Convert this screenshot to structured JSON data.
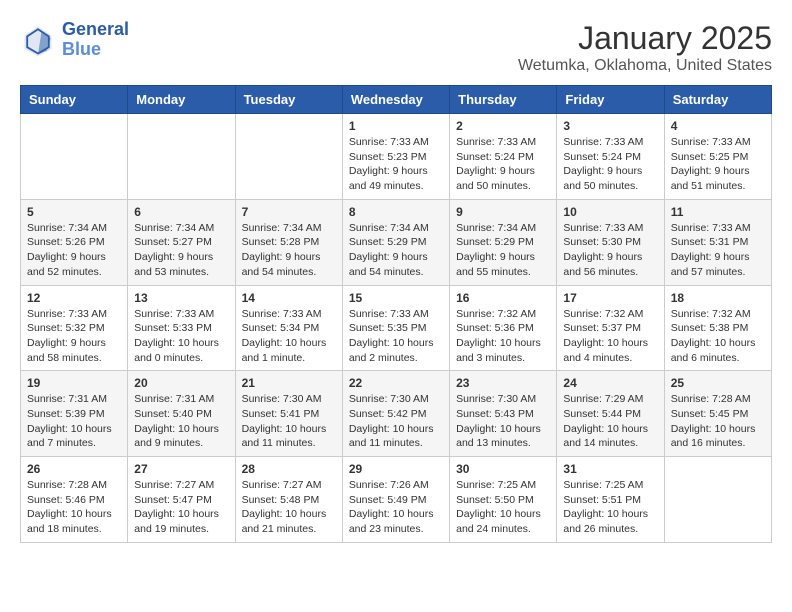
{
  "logo": {
    "line1": "General",
    "line2": "Blue"
  },
  "title": "January 2025",
  "subtitle": "Wetumka, Oklahoma, United States",
  "weekdays": [
    "Sunday",
    "Monday",
    "Tuesday",
    "Wednesday",
    "Thursday",
    "Friday",
    "Saturday"
  ],
  "weeks": [
    [
      {
        "day": "",
        "info": ""
      },
      {
        "day": "",
        "info": ""
      },
      {
        "day": "",
        "info": ""
      },
      {
        "day": "1",
        "info": "Sunrise: 7:33 AM\nSunset: 5:23 PM\nDaylight: 9 hours\nand 49 minutes."
      },
      {
        "day": "2",
        "info": "Sunrise: 7:33 AM\nSunset: 5:24 PM\nDaylight: 9 hours\nand 50 minutes."
      },
      {
        "day": "3",
        "info": "Sunrise: 7:33 AM\nSunset: 5:24 PM\nDaylight: 9 hours\nand 50 minutes."
      },
      {
        "day": "4",
        "info": "Sunrise: 7:33 AM\nSunset: 5:25 PM\nDaylight: 9 hours\nand 51 minutes."
      }
    ],
    [
      {
        "day": "5",
        "info": "Sunrise: 7:34 AM\nSunset: 5:26 PM\nDaylight: 9 hours\nand 52 minutes."
      },
      {
        "day": "6",
        "info": "Sunrise: 7:34 AM\nSunset: 5:27 PM\nDaylight: 9 hours\nand 53 minutes."
      },
      {
        "day": "7",
        "info": "Sunrise: 7:34 AM\nSunset: 5:28 PM\nDaylight: 9 hours\nand 54 minutes."
      },
      {
        "day": "8",
        "info": "Sunrise: 7:34 AM\nSunset: 5:29 PM\nDaylight: 9 hours\nand 54 minutes."
      },
      {
        "day": "9",
        "info": "Sunrise: 7:34 AM\nSunset: 5:29 PM\nDaylight: 9 hours\nand 55 minutes."
      },
      {
        "day": "10",
        "info": "Sunrise: 7:33 AM\nSunset: 5:30 PM\nDaylight: 9 hours\nand 56 minutes."
      },
      {
        "day": "11",
        "info": "Sunrise: 7:33 AM\nSunset: 5:31 PM\nDaylight: 9 hours\nand 57 minutes."
      }
    ],
    [
      {
        "day": "12",
        "info": "Sunrise: 7:33 AM\nSunset: 5:32 PM\nDaylight: 9 hours\nand 58 minutes."
      },
      {
        "day": "13",
        "info": "Sunrise: 7:33 AM\nSunset: 5:33 PM\nDaylight: 10 hours\nand 0 minutes."
      },
      {
        "day": "14",
        "info": "Sunrise: 7:33 AM\nSunset: 5:34 PM\nDaylight: 10 hours\nand 1 minute."
      },
      {
        "day": "15",
        "info": "Sunrise: 7:33 AM\nSunset: 5:35 PM\nDaylight: 10 hours\nand 2 minutes."
      },
      {
        "day": "16",
        "info": "Sunrise: 7:32 AM\nSunset: 5:36 PM\nDaylight: 10 hours\nand 3 minutes."
      },
      {
        "day": "17",
        "info": "Sunrise: 7:32 AM\nSunset: 5:37 PM\nDaylight: 10 hours\nand 4 minutes."
      },
      {
        "day": "18",
        "info": "Sunrise: 7:32 AM\nSunset: 5:38 PM\nDaylight: 10 hours\nand 6 minutes."
      }
    ],
    [
      {
        "day": "19",
        "info": "Sunrise: 7:31 AM\nSunset: 5:39 PM\nDaylight: 10 hours\nand 7 minutes."
      },
      {
        "day": "20",
        "info": "Sunrise: 7:31 AM\nSunset: 5:40 PM\nDaylight: 10 hours\nand 9 minutes."
      },
      {
        "day": "21",
        "info": "Sunrise: 7:30 AM\nSunset: 5:41 PM\nDaylight: 10 hours\nand 11 minutes."
      },
      {
        "day": "22",
        "info": "Sunrise: 7:30 AM\nSunset: 5:42 PM\nDaylight: 10 hours\nand 11 minutes."
      },
      {
        "day": "23",
        "info": "Sunrise: 7:30 AM\nSunset: 5:43 PM\nDaylight: 10 hours\nand 13 minutes."
      },
      {
        "day": "24",
        "info": "Sunrise: 7:29 AM\nSunset: 5:44 PM\nDaylight: 10 hours\nand 14 minutes."
      },
      {
        "day": "25",
        "info": "Sunrise: 7:28 AM\nSunset: 5:45 PM\nDaylight: 10 hours\nand 16 minutes."
      }
    ],
    [
      {
        "day": "26",
        "info": "Sunrise: 7:28 AM\nSunset: 5:46 PM\nDaylight: 10 hours\nand 18 minutes."
      },
      {
        "day": "27",
        "info": "Sunrise: 7:27 AM\nSunset: 5:47 PM\nDaylight: 10 hours\nand 19 minutes."
      },
      {
        "day": "28",
        "info": "Sunrise: 7:27 AM\nSunset: 5:48 PM\nDaylight: 10 hours\nand 21 minutes."
      },
      {
        "day": "29",
        "info": "Sunrise: 7:26 AM\nSunset: 5:49 PM\nDaylight: 10 hours\nand 23 minutes."
      },
      {
        "day": "30",
        "info": "Sunrise: 7:25 AM\nSunset: 5:50 PM\nDaylight: 10 hours\nand 24 minutes."
      },
      {
        "day": "31",
        "info": "Sunrise: 7:25 AM\nSunset: 5:51 PM\nDaylight: 10 hours\nand 26 minutes."
      },
      {
        "day": "",
        "info": ""
      }
    ]
  ]
}
